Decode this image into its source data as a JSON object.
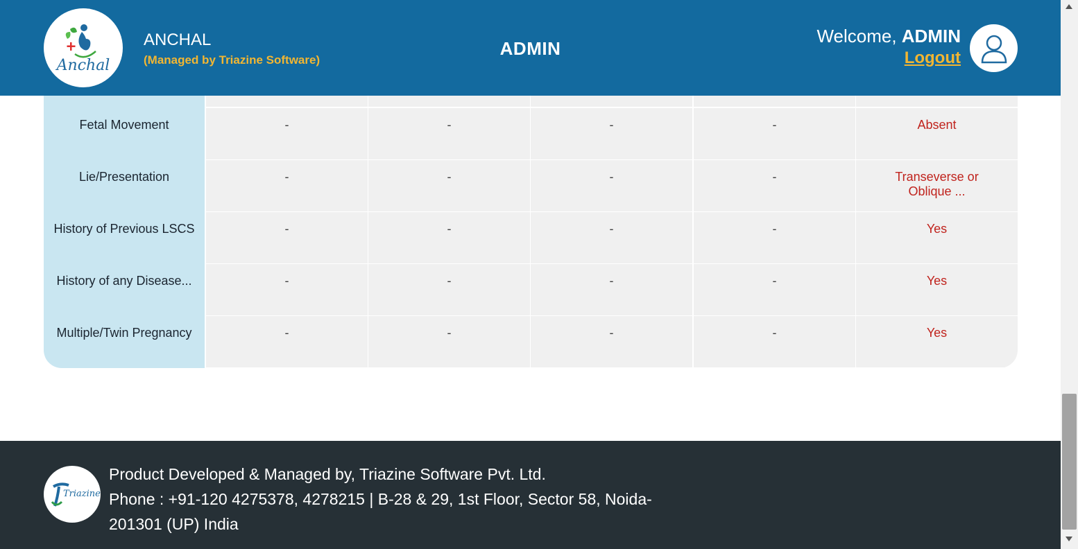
{
  "header": {
    "app_name": "ANCHAL",
    "app_sub": "(Managed by Triazine Software)",
    "logo_text": "Anchal",
    "role_title": "ADMIN",
    "welcome_prefix": "Welcome, ",
    "welcome_user": "ADMIN",
    "logout_label": "Logout"
  },
  "table": {
    "rows": [
      {
        "label": "Fetal Movement",
        "values": [
          "-",
          "-",
          "-",
          "-",
          "Absent"
        ]
      },
      {
        "label": "Lie/Presentation",
        "values": [
          "-",
          "-",
          "-",
          "-",
          "Transeverse or Oblique ..."
        ]
      },
      {
        "label": "History of Previous LSCS",
        "values": [
          "-",
          "-",
          "-",
          "-",
          "Yes"
        ]
      },
      {
        "label": "History of any Disease...",
        "values": [
          "-",
          "-",
          "-",
          "-",
          "Yes"
        ]
      },
      {
        "label": "Multiple/Twin Pregnancy",
        "values": [
          "-",
          "-",
          "-",
          "-",
          "Yes"
        ]
      }
    ]
  },
  "footer": {
    "logo_text": "Triazine",
    "line1": "Product Developed & Managed by, Triazine Software Pvt. Ltd.",
    "line2": "Phone : +91-120 4275378, 4278215 | B-28 & 29, 1st Floor, Sector 58, Noida-201301 (UP) India"
  },
  "colors": {
    "header_bg": "#136a9f",
    "accent_yellow": "#f2b632",
    "label_col_bg": "#c9e6f1",
    "cell_bg": "#f0f0f0",
    "warn_red": "#c0231d",
    "footer_bg": "#263036"
  },
  "icons": {
    "user": "user-avatar-icon",
    "scroll_up": "chevron-up-icon",
    "scroll_down": "chevron-down-icon"
  }
}
